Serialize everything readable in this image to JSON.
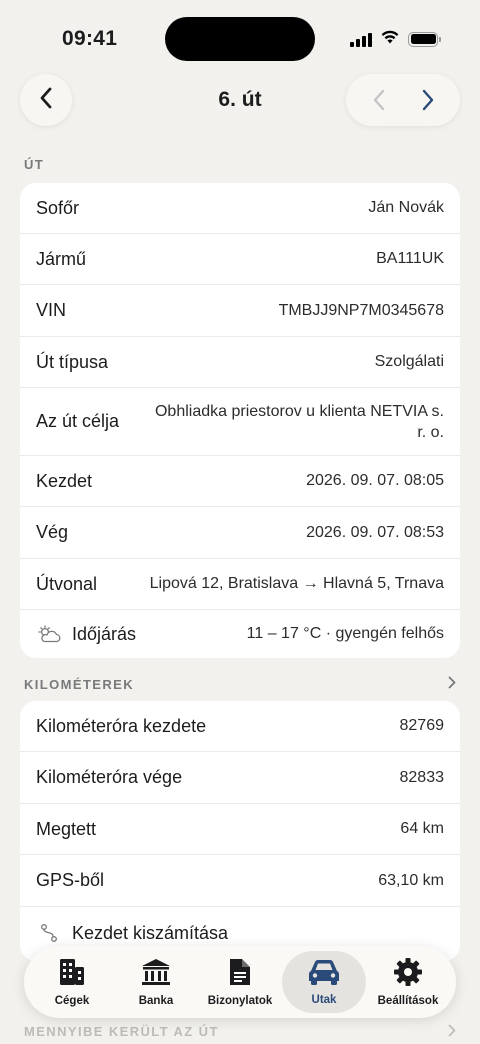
{
  "status": {
    "time": "09:41"
  },
  "nav": {
    "title": "6. út"
  },
  "trip_section": {
    "title": "ÚT"
  },
  "trip_rows": [
    {
      "label": "Sofőr",
      "value": "Ján Novák"
    },
    {
      "label": "Jármű",
      "value": "BA111UK"
    },
    {
      "label": "VIN",
      "value": "TMBJJ9NP7M0345678"
    },
    {
      "label": "Út típusa",
      "value": "Szolgálati"
    },
    {
      "label": "Az út célja",
      "value": "Obhliadka priestorov u klienta NETVIA s. r. o."
    },
    {
      "label": "Kezdet",
      "value": "2026. 09. 07. 08:05"
    },
    {
      "label": "Vég",
      "value": "2026. 09. 07. 08:53"
    },
    {
      "label": "Útvonal",
      "value": "Lipová 12, Bratislava → Hlavná 5, Trnava"
    },
    {
      "label": "Időjárás",
      "value": "11 – 17 °C · gyengén felhős",
      "icon": "partly-cloudy-icon"
    }
  ],
  "km_section": {
    "title": "KILOMÉTEREK"
  },
  "km_rows": [
    {
      "label": "Kilométeróra kezdete",
      "value": "82769"
    },
    {
      "label": "Kilométeróra vége",
      "value": "82833"
    },
    {
      "label": "Megtett",
      "value": "64 km"
    },
    {
      "label": "GPS-ből",
      "value": "63,10 km"
    },
    {
      "label": "Kezdet kiszámítása",
      "icon": "route-icon"
    }
  ],
  "cost_section": {
    "title": "MENNYIBE KERÜLT AZ ÚT"
  },
  "tabs": [
    {
      "label": "Cégek",
      "icon": "building-icon"
    },
    {
      "label": "Banka",
      "icon": "bank-icon"
    },
    {
      "label": "Bizonylatok",
      "icon": "document-icon"
    },
    {
      "label": "Utak",
      "icon": "car-icon",
      "active": true
    },
    {
      "label": "Beállítások",
      "icon": "gear-icon"
    }
  ],
  "colors": {
    "background": "#f2f1ed",
    "card": "#ffffff",
    "accent": "#2a4a7a"
  }
}
